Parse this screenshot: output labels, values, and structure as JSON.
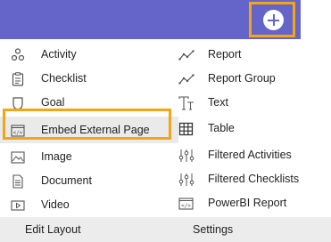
{
  "header": {
    "add_icon": "plus-circle-icon",
    "brand_color": "#6565c9",
    "highlight_color": "#f2a516"
  },
  "menu": {
    "left": [
      {
        "label": "Activity",
        "icon": "molecule-icon"
      },
      {
        "label": "Checklist",
        "icon": "checklist-icon"
      },
      {
        "label": "Goal",
        "icon": "shield-icon"
      },
      {
        "label": "Embed External Page",
        "icon": "code-window-icon"
      },
      {
        "label": "Image",
        "icon": "image-icon"
      },
      {
        "label": "Document",
        "icon": "document-icon"
      },
      {
        "label": "Video",
        "icon": "video-play-icon"
      }
    ],
    "right": [
      {
        "label": "Report",
        "icon": "line-chart-icon"
      },
      {
        "label": "Report Group",
        "icon": "line-chart-icon"
      },
      {
        "label": "Text",
        "icon": "text-icon"
      },
      {
        "label": "Table",
        "icon": "table-icon"
      },
      {
        "label": "Filtered Activities",
        "icon": "filter-sliders-icon"
      },
      {
        "label": "Filtered Checklists",
        "icon": "filter-sliders-icon"
      },
      {
        "label": "PowerBI Report",
        "icon": "code-window-icon"
      }
    ]
  },
  "footer": {
    "edit_layout": "Edit Layout",
    "settings": "Settings"
  }
}
